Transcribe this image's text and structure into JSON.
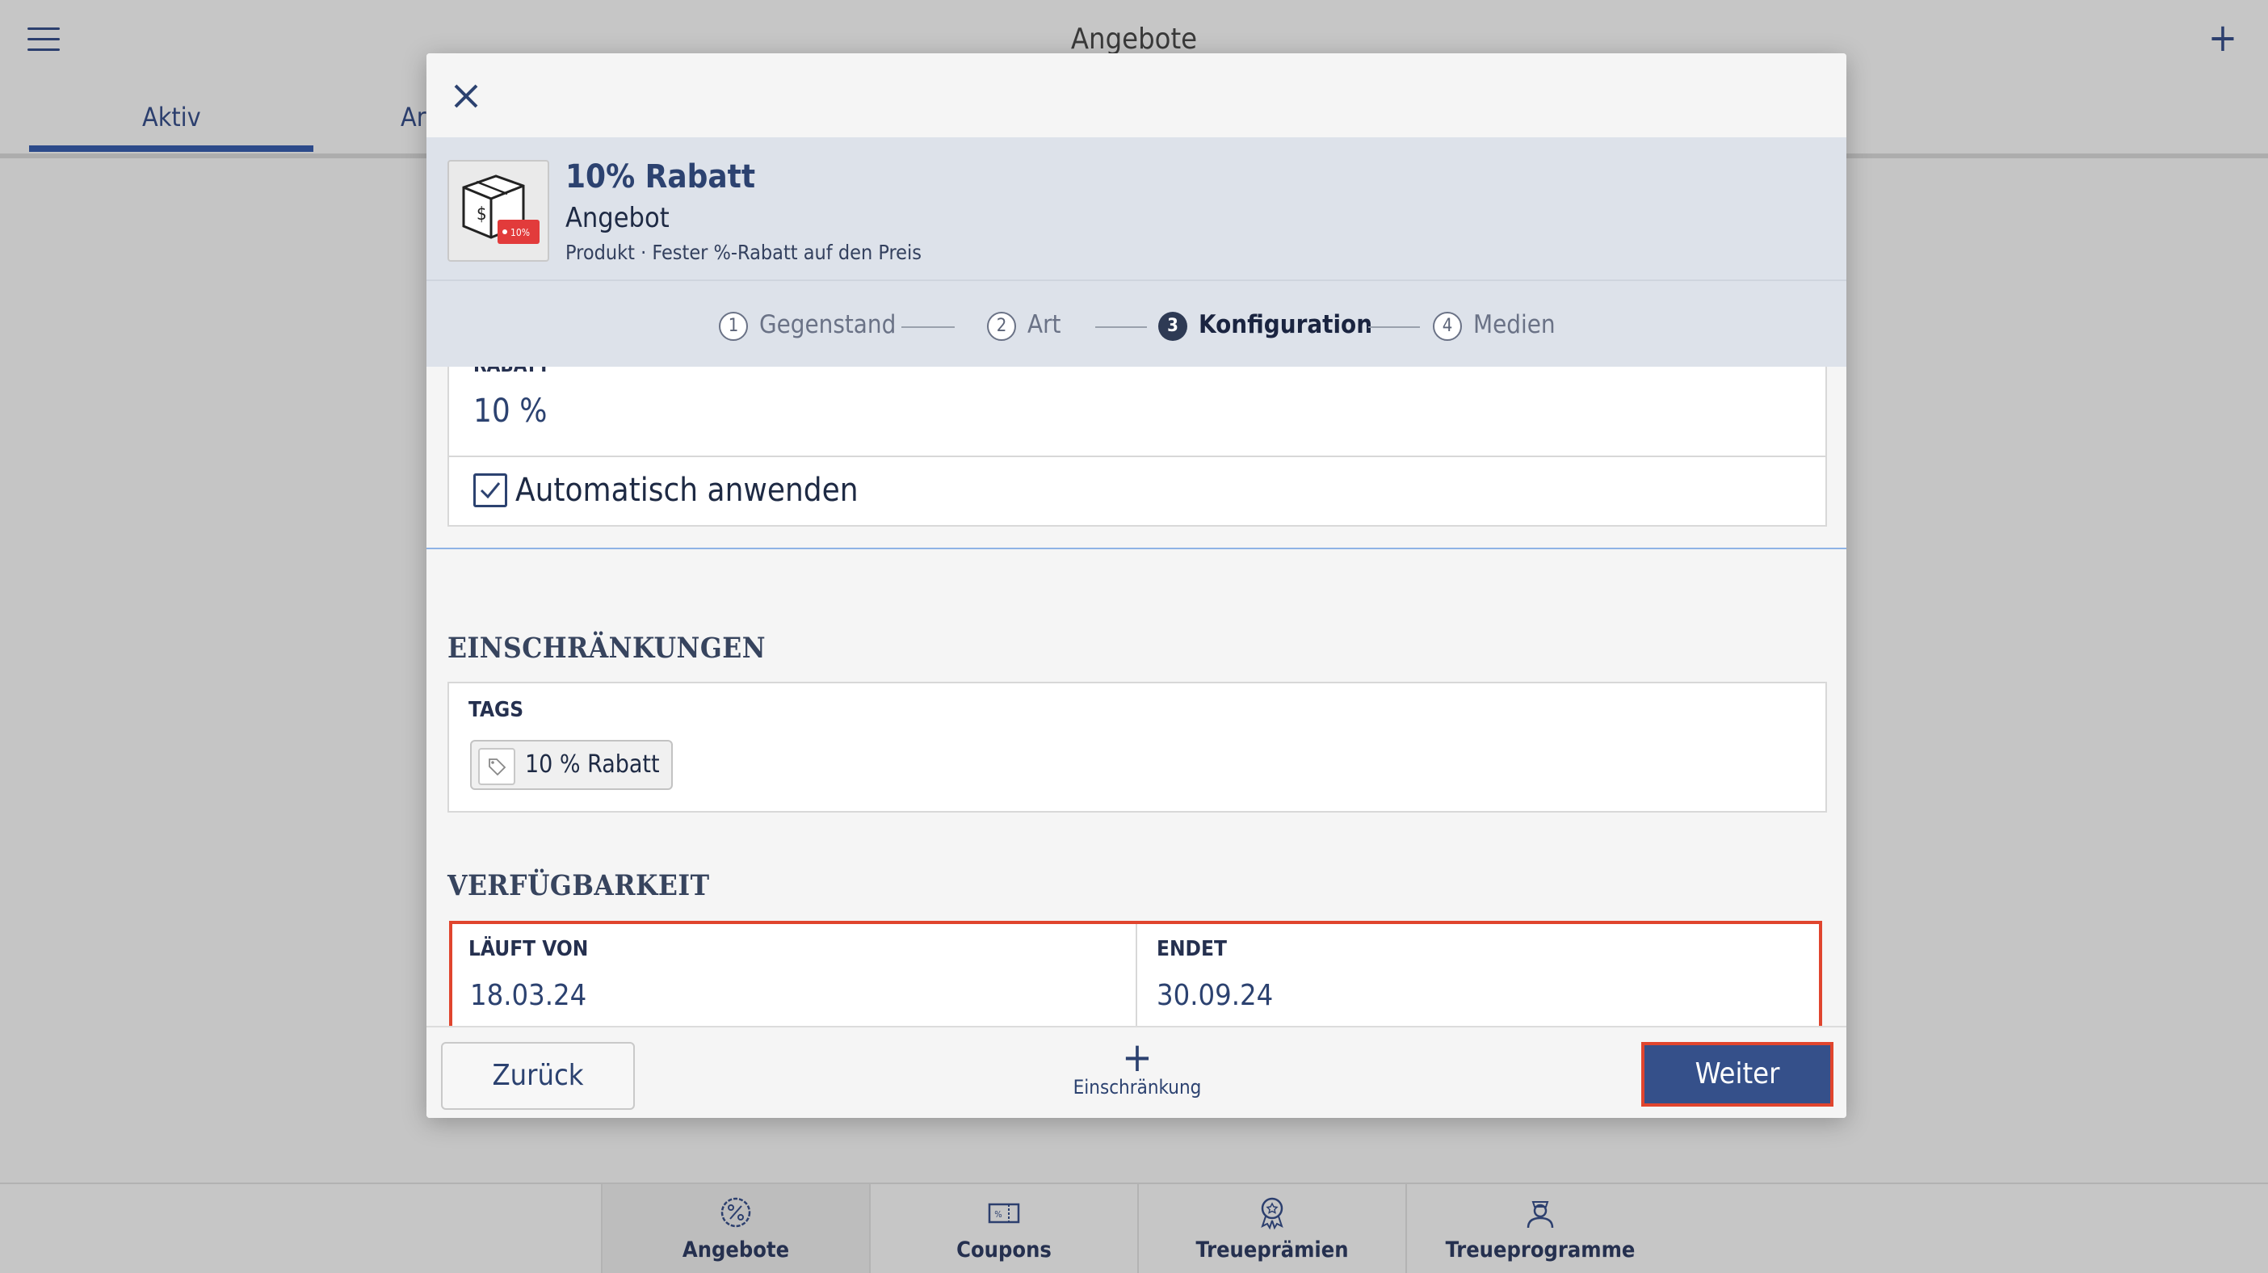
{
  "app": {
    "title": "Angebote",
    "menu_icon": "hamburger-icon",
    "add_icon": "plus-icon"
  },
  "tabs": [
    {
      "label": "Aktiv"
    },
    {
      "label": "Ar"
    }
  ],
  "bottom_nav": [
    {
      "label": "Angebote",
      "icon": "percent-badge-icon"
    },
    {
      "label": "Coupons",
      "icon": "coupon-icon"
    },
    {
      "label": "Treueprämien",
      "icon": "award-icon"
    },
    {
      "label": "Treueprogramme",
      "icon": "person-badge-icon"
    }
  ],
  "modal": {
    "close_icon": "close-icon",
    "product": {
      "name": "10% Rabatt",
      "type": "Angebot",
      "description": "Produkt · Fester %-Rabatt auf den Preis",
      "thumb_badge": "10%"
    },
    "steps": [
      {
        "num": "1",
        "label": "Gegenstand"
      },
      {
        "num": "2",
        "label": "Art"
      },
      {
        "num": "3",
        "label": "Konfiguration"
      },
      {
        "num": "4",
        "label": "Medien"
      }
    ],
    "rabatt": {
      "label": "RABATT",
      "value": "10 %"
    },
    "auto_apply": {
      "label": "Automatisch anwenden",
      "checked": true
    },
    "restrictions": {
      "title": "EINSCHRÄNKUNGEN",
      "tags_label": "TAGS",
      "tag": "10 % Rabatt"
    },
    "availability": {
      "title": "VERFÜGBARKEIT",
      "from_label": "LÄUFT VON",
      "from_value": "18.03.24",
      "to_label": "ENDET",
      "to_value": "30.09.24"
    },
    "footer": {
      "back_label": "Zurück",
      "add_label": "Einschränkung",
      "add_symbol": "+",
      "next_label": "Weiter"
    }
  },
  "colors": {
    "accent": "#35508a",
    "highlight": "#e0452e",
    "badge_red": "#e23b3b"
  }
}
